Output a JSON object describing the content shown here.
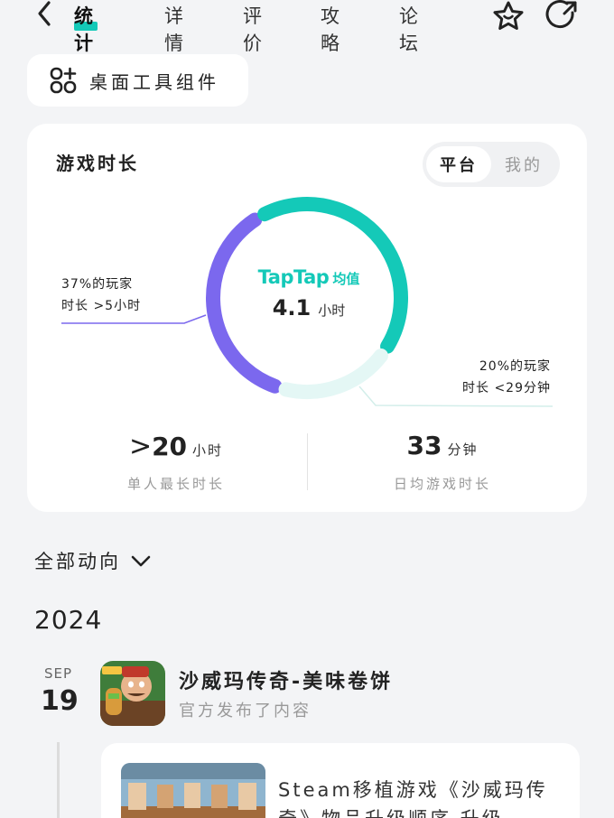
{
  "nav": {
    "tabs": [
      {
        "label": "统计",
        "active": true
      },
      {
        "label": "详情",
        "active": false
      },
      {
        "label": "评价",
        "active": false
      },
      {
        "label": "攻略",
        "active": false
      },
      {
        "label": "论坛",
        "active": false
      }
    ]
  },
  "widget_button": {
    "label": "桌面工具组件"
  },
  "play_time": {
    "title": "游戏时长",
    "toggle": {
      "platform": "平台",
      "mine": "我的",
      "selected": "平台"
    },
    "center": {
      "brand": "TapTap",
      "avg_label": "均值",
      "value": "4.1",
      "unit": "小时"
    },
    "annotation_left": {
      "line1": "37%的玩家",
      "line2": "时长 >5小时"
    },
    "annotation_right": {
      "line1": "20%的玩家",
      "line2": "时长 <29分钟"
    },
    "ring_segments": [
      {
        "name": "over-5h",
        "percent": 37,
        "color": "#7b68ee"
      },
      {
        "name": "middle",
        "percent": 43,
        "color": "#14c9b8"
      },
      {
        "name": "under-29m",
        "percent": 20,
        "color": "#e4f7f5"
      }
    ],
    "metrics": [
      {
        "prefix": ">",
        "value": "20",
        "unit": "小时",
        "caption": "单人最长时长"
      },
      {
        "prefix": "",
        "value": "33",
        "unit": "分钟",
        "caption": "日均游戏时长"
      }
    ]
  },
  "activity": {
    "filter_label": "全部动向",
    "year": "2024",
    "entry": {
      "month": "SEP",
      "day": "19",
      "game_title": "沙威玛传奇-美味卷饼",
      "subtitle": "官方发布了内容",
      "post_text": "Steam移植游戏《沙威玛传奇》物品升级顺序 升级"
    }
  },
  "colors": {
    "accent": "#14c9b8",
    "purple": "#7b68ee",
    "pale_teal": "#e4f7f5",
    "background": "#f3f4f6"
  },
  "icons": [
    "back-arrow-icon",
    "star-icon",
    "share-icon",
    "widget-grid-icon",
    "chevron-down-icon"
  ]
}
